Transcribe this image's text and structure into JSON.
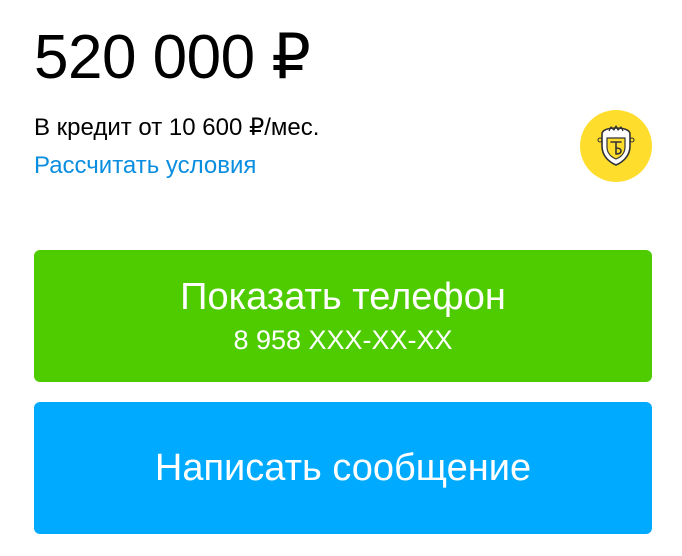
{
  "listing": {
    "price": "520 000 ₽",
    "credit_text": "В кредит от 10 600 ₽/мес.",
    "credit_link": "Рассчитать условия"
  },
  "bank_logo": {
    "icon": "tinkoff-bank-logo-icon",
    "color": "#ffdd2d"
  },
  "actions": {
    "phone_title": "Показать телефон",
    "phone_number": "8 958 XXX-XX-XX",
    "message_title": "Написать сообщение"
  },
  "colors": {
    "link": "#0a8ee0",
    "phone_button": "#4ecc00",
    "message_button": "#00aaff"
  }
}
